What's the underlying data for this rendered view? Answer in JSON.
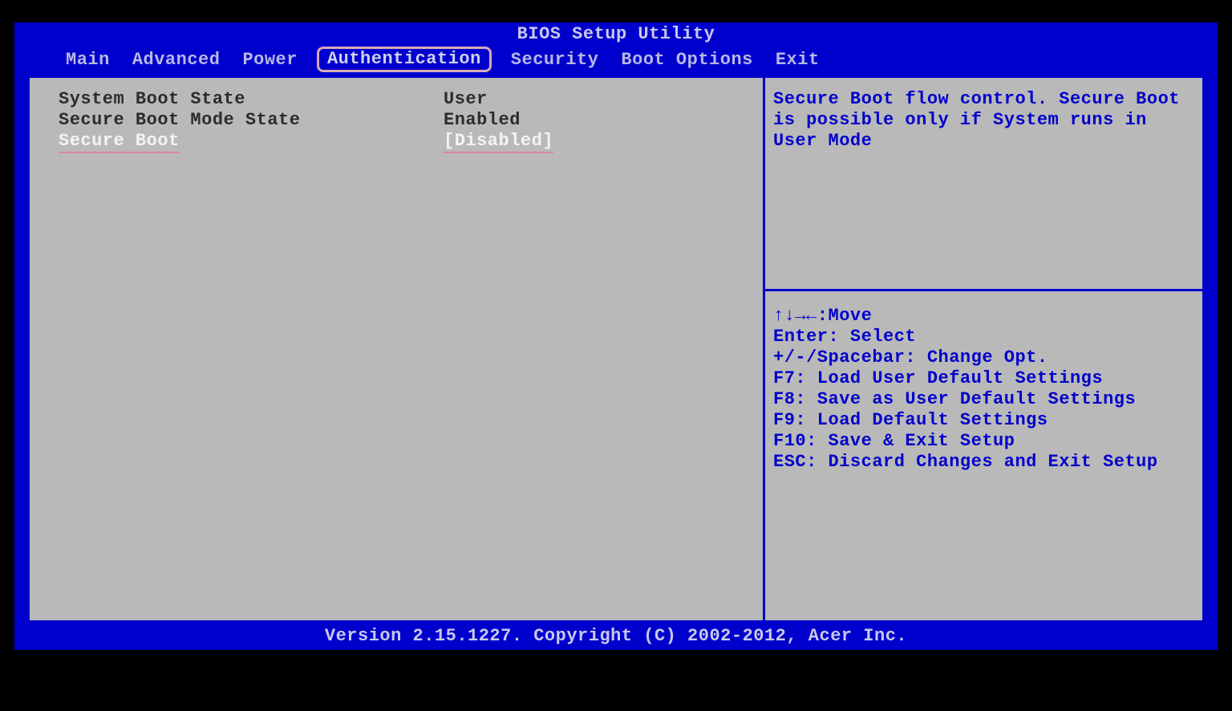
{
  "title": "BIOS Setup Utility",
  "menu": [
    "Main",
    "Advanced",
    "Power",
    "Authentication",
    "Security",
    "Boot Options",
    "Exit"
  ],
  "active_tab": "Authentication",
  "settings": [
    {
      "label": "System Boot State",
      "value": "User",
      "selected": false
    },
    {
      "label": "Secure Boot Mode State",
      "value": "Enabled",
      "selected": false
    },
    {
      "label": "Secure Boot",
      "value": "[Disabled]",
      "selected": true
    }
  ],
  "help_text": "Secure Boot flow control. Secure Boot is possible only if System runs in User Mode",
  "nav": [
    "↑↓→←:Move",
    "Enter: Select",
    "+/-/Spacebar: Change Opt.",
    "F7: Load User Default Settings",
    "F8: Save as User Default Settings",
    "F9: Load Default Settings",
    "F10: Save & Exit Setup",
    "ESC: Discard Changes and Exit Setup"
  ],
  "footer": "Version 2.15.1227. Copyright (C) 2002-2012, Acer Inc."
}
